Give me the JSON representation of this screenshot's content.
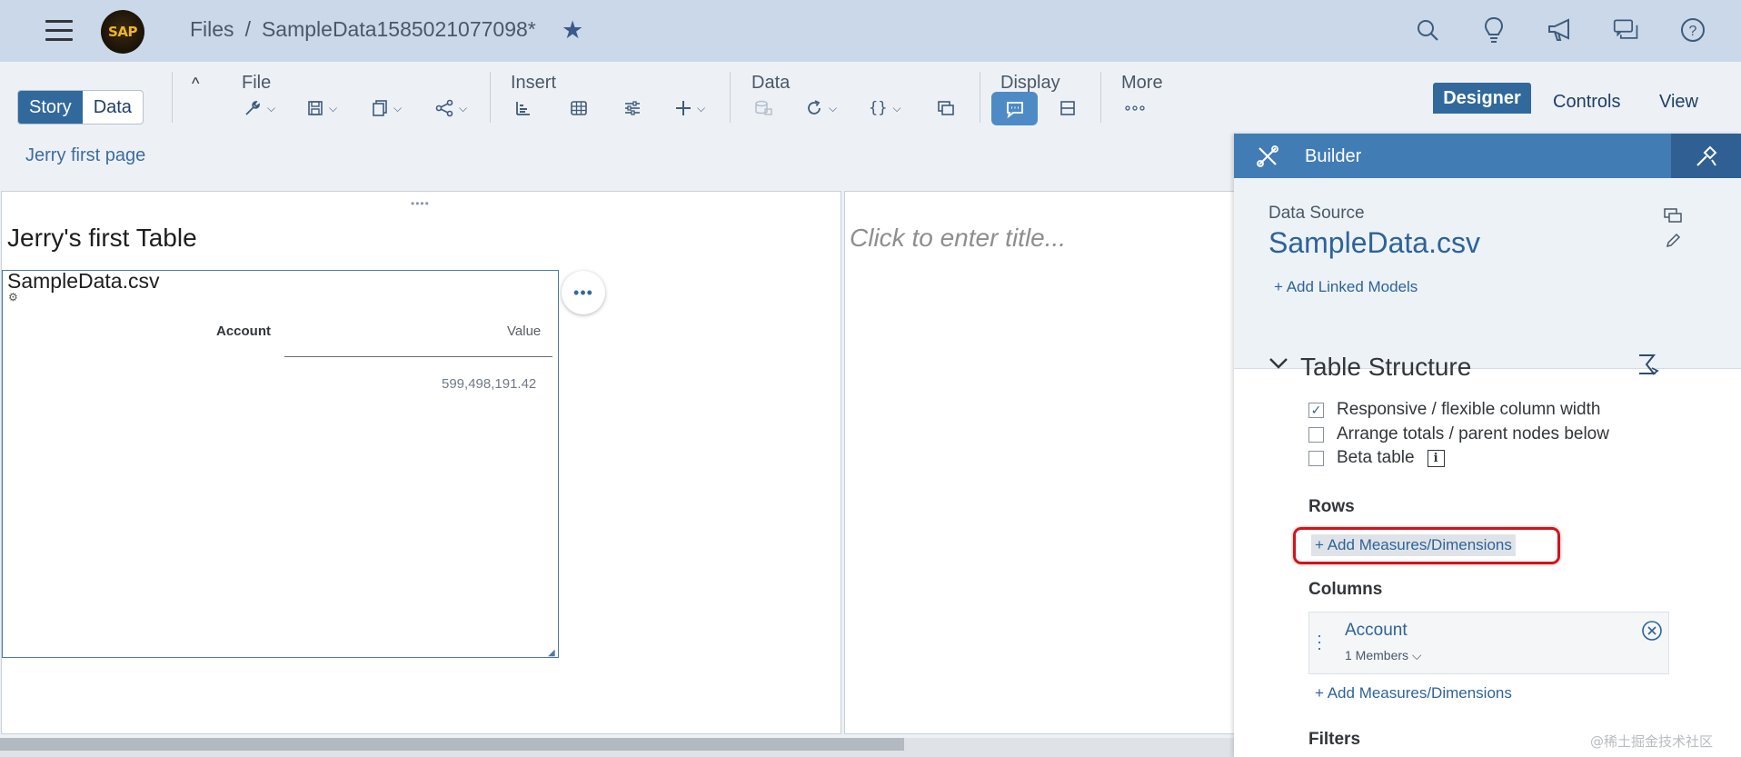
{
  "shell": {
    "breadcrumb_root": "Files",
    "breadcrumb_sep": "/",
    "breadcrumb_file": "SampleData1585021077098*",
    "logo_text": "SAP",
    "icons": [
      "search-icon",
      "lightbulb-icon",
      "megaphone-icon",
      "feedback-icon",
      "help-icon"
    ]
  },
  "toolbar": {
    "mode_story": "Story",
    "mode_data": "Data",
    "groups": {
      "file": "File",
      "insert": "Insert",
      "data": "Data",
      "display": "Display",
      "more": "More"
    },
    "tabs": {
      "designer": "Designer",
      "controls": "Controls",
      "view": "View"
    }
  },
  "page": {
    "tab_name": "Jerry first page"
  },
  "canvas": {
    "left_title": "Jerry's first Table",
    "right_placeholder": "Click to enter title...",
    "table": {
      "title": "SampleData.csv",
      "col_account": "Account",
      "col_value": "Value",
      "value": "599,498,191.42"
    }
  },
  "builder": {
    "header": "Builder",
    "data_source_label": "Data Source",
    "data_source_name": "SampleData.csv",
    "add_linked_models": "Add Linked Models",
    "table_structure": "Table Structure",
    "options": [
      {
        "label": "Responsive / flexible column width",
        "checked": true
      },
      {
        "label": "Arrange totals / parent nodes below",
        "checked": false
      },
      {
        "label": "Beta table",
        "checked": false
      }
    ],
    "rows_label": "Rows",
    "rows_add": "Add Measures/Dimensions",
    "columns_label": "Columns",
    "columns_item": {
      "name": "Account",
      "members": "1 Members"
    },
    "columns_add": "Add Measures/Dimensions",
    "filters_label": "Filters"
  },
  "watermark": "@稀土掘金技术社区",
  "colors": {
    "shell_bg": "#cad8ea",
    "accent": "#31699c",
    "builder_header": "#427cb5",
    "highlight_ring": "#d0141b"
  }
}
